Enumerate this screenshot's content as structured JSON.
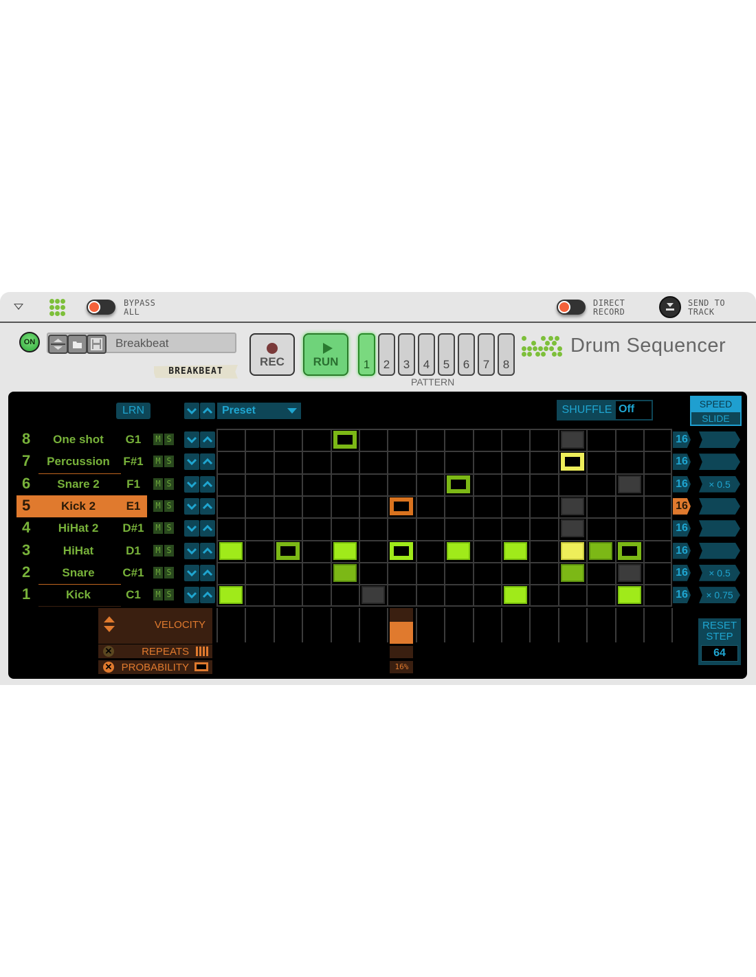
{
  "topbar": {
    "collapse_icon": "triangle-down-icon",
    "device_icon": "dot-grid-icon",
    "bypass_label_1": "BYPASS",
    "bypass_label_2": "ALL",
    "direct_record_label_1": "DIRECT",
    "direct_record_label_2": "RECORD",
    "send_to_track_label_1": "SEND TO",
    "send_to_track_label_2": "TRACK"
  },
  "header": {
    "on_label": "ON",
    "patch_name": "Breakbeat",
    "tape_label": "BREAKBEAT",
    "rec_label": "REC",
    "run_label": "RUN",
    "pattern_label": "PATTERN",
    "patterns": [
      "1",
      "2",
      "3",
      "4",
      "5",
      "6",
      "7",
      "8"
    ],
    "active_pattern": "1",
    "title": "Drum Sequencer"
  },
  "controls": {
    "lrn_label": "LRN",
    "preset_label": "Preset",
    "shuffle_label": "SHUFFLE",
    "shuffle_value": "Off",
    "speed_label": "SPEED",
    "slide_label": "SLIDE"
  },
  "lanes": [
    {
      "num": "8",
      "name": "One shot",
      "note": "G1",
      "length": "16",
      "rate": ""
    },
    {
      "num": "7",
      "name": "Percussion",
      "note": "F#1",
      "length": "16",
      "rate": ""
    },
    {
      "num": "6",
      "name": "Snare 2",
      "note": "F1",
      "length": "16",
      "rate": "× 0.5"
    },
    {
      "num": "5",
      "name": "Kick 2",
      "note": "E1",
      "length": "16",
      "rate": "",
      "selected": true
    },
    {
      "num": "4",
      "name": "HiHat 2",
      "note": "D#1",
      "length": "16",
      "rate": ""
    },
    {
      "num": "3",
      "name": "HiHat",
      "note": "D1",
      "length": "16",
      "rate": ""
    },
    {
      "num": "2",
      "name": "Snare",
      "note": "C#1",
      "length": "16",
      "rate": "× 0.5"
    },
    {
      "num": "1",
      "name": "Kick",
      "note": "C1",
      "length": "16",
      "rate": "× 0.75"
    }
  ],
  "mute_label": "M",
  "solo_label": "S",
  "grid": {
    "steps": 16,
    "cells": [
      {
        "lane": 0,
        "step": 4,
        "state": "outline-medium"
      },
      {
        "lane": 0,
        "step": 12,
        "state": "gray"
      },
      {
        "lane": 1,
        "step": 12,
        "state": "outline-yellow"
      },
      {
        "lane": 2,
        "step": 8,
        "state": "outline-medium"
      },
      {
        "lane": 2,
        "step": 14,
        "state": "gray"
      },
      {
        "lane": 3,
        "step": 6,
        "state": "outline-orange"
      },
      {
        "lane": 3,
        "step": 12,
        "state": "gray"
      },
      {
        "lane": 4,
        "step": 12,
        "state": "gray"
      },
      {
        "lane": 5,
        "step": 0,
        "state": "bright"
      },
      {
        "lane": 5,
        "step": 2,
        "state": "outline-medium"
      },
      {
        "lane": 5,
        "step": 4,
        "state": "bright"
      },
      {
        "lane": 5,
        "step": 6,
        "state": "outline-bright"
      },
      {
        "lane": 5,
        "step": 8,
        "state": "bright"
      },
      {
        "lane": 5,
        "step": 10,
        "state": "bright"
      },
      {
        "lane": 5,
        "step": 12,
        "state": "yellow"
      },
      {
        "lane": 5,
        "step": 13,
        "state": "medium"
      },
      {
        "lane": 5,
        "step": 14,
        "state": "outline-medium"
      },
      {
        "lane": 6,
        "step": 4,
        "state": "medium"
      },
      {
        "lane": 6,
        "step": 12,
        "state": "medium"
      },
      {
        "lane": 6,
        "step": 14,
        "state": "gray"
      },
      {
        "lane": 7,
        "step": 0,
        "state": "bright"
      },
      {
        "lane": 7,
        "step": 5,
        "state": "gray"
      },
      {
        "lane": 7,
        "step": 10,
        "state": "bright"
      },
      {
        "lane": 7,
        "step": 14,
        "state": "bright"
      }
    ]
  },
  "edit": {
    "velocity_label": "VELOCITY",
    "repeats_label": "REPEATS",
    "probability_label": "PROBABILITY",
    "selected_step": 6,
    "velocity_fraction": 0.62,
    "probability_value": "16%"
  },
  "reset": {
    "label_1": "RESET",
    "label_2": "STEP",
    "value": "64"
  },
  "colors": {
    "accent_green": "#a0ea1a",
    "accent_orange": "#e07a2e",
    "accent_teal": "#1fa5d0"
  }
}
